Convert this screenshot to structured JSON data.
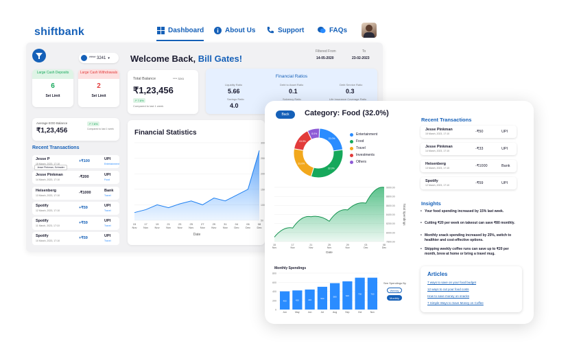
{
  "colors": {
    "brand": "#1560b8",
    "accent": "#2a8cff",
    "success": "#16a85b",
    "danger": "#e23b3b"
  },
  "nav": {
    "logo": "shiftbank",
    "items": [
      {
        "label": "Dashboard",
        "icon": "dashboard-icon",
        "active": true
      },
      {
        "label": "About Us",
        "icon": "info-icon",
        "active": false
      },
      {
        "label": "Support",
        "icon": "phone-icon",
        "active": false
      },
      {
        "label": "FAQs",
        "icon": "chat-icon",
        "active": false
      }
    ]
  },
  "dashboard": {
    "account": "**** 3241",
    "welcome": "Welcome Back,",
    "user": "Bill Gates!",
    "filter": {
      "from_label": "Filtered From",
      "to_label": "To",
      "from": "14-05-2020",
      "to": "23-02-2023"
    },
    "large_deposits": {
      "label": "Large Cash Deposits",
      "count": "6",
      "action": "Set Limit"
    },
    "large_withdrawals": {
      "label": "Large Cash Withdrawals",
      "count": "2",
      "action": "Set Limit"
    },
    "balance": {
      "label": "Total Balance",
      "account": "**** 3241",
      "value": "₹1,23,456",
      "change": "↗ 7.6%",
      "note": "Compared to last 1 week"
    },
    "eod": {
      "label": "Average EOD Balance",
      "value": "₹1,23,456",
      "change": "↗ 7.6%",
      "note": "Compared to last 1 week"
    },
    "ratios": {
      "title": "Financial Ratios",
      "items": [
        {
          "label": "Liquidity Ratio",
          "value": "5.66"
        },
        {
          "label": "Debt to Asset Ratio",
          "value": "0.1"
        },
        {
          "label": "Debt Service Ratio",
          "value": "0.3"
        },
        {
          "label": "Savings Ratio",
          "value": "4.0"
        },
        {
          "label": "Solvency Ratio",
          "value": ""
        },
        {
          "label": "Life Insurance Coverage Ratio",
          "value": ""
        }
      ]
    },
    "stats": {
      "title": "Financial Statistics",
      "xlabel": "Date"
    },
    "recent_title": "Recent Transactions",
    "tooltip": "Jesse Pinkman, Schrader",
    "transactions": [
      {
        "name": "Jesse P",
        "date": "15 March, 2023, 17:10",
        "amount": "+₹100",
        "mode": "UPI",
        "category": "Entertainment"
      },
      {
        "name": "Jesse Pinkman",
        "date": "14 March, 2023, 17:10",
        "amount": "-₹200",
        "mode": "UPI",
        "category": "Food"
      },
      {
        "name": "Heisenberg",
        "date": "13 March, 2023, 17:10",
        "amount": "-₹1000",
        "mode": "Bank",
        "category": "Travel"
      },
      {
        "name": "Spotify",
        "date": "12 March, 2023, 17:10",
        "amount": "+₹59",
        "mode": "UPI",
        "category": "Travel"
      },
      {
        "name": "Spotify",
        "date": "11 March, 2023, 17:10",
        "amount": "+₹59",
        "mode": "UPI",
        "category": "Travel"
      },
      {
        "name": "Spotify",
        "date": "10 March, 2023, 17:10",
        "amount": "+₹59",
        "mode": "UPI",
        "category": "Travel"
      }
    ]
  },
  "food": {
    "back": "Back",
    "title": "Category: Food (32.0%)",
    "legend": [
      {
        "label": "Entertainment",
        "color": "#2a8cff"
      },
      {
        "label": "Food",
        "color": "#16a85b"
      },
      {
        "label": "Travel",
        "color": "#f2a81d"
      },
      {
        "label": "Investments",
        "color": "#e23b3b"
      },
      {
        "label": "Others",
        "color": "#8e5bd6"
      }
    ],
    "recent_title": "Recent Transactions",
    "transactions": [
      {
        "name": "Jesse Pinkman",
        "date": "15 March, 2023, 17:10",
        "amount": "-₹50",
        "mode": "UPI"
      },
      {
        "name": "Jesse Pinkman",
        "date": "14 March, 2023, 17:10",
        "amount": "-₹33",
        "mode": "UPI"
      },
      {
        "name": "Heisenberg",
        "date": "13 March, 2023, 17:10",
        "amount": "-₹1000",
        "mode": "Bank"
      },
      {
        "name": "Spotify",
        "date": "12 March, 2023, 17:10",
        "amount": "-₹59",
        "mode": "UPI"
      }
    ],
    "insights_title": "Insights",
    "insights": [
      "Your food spending increased by 15% last week.",
      "Cutting ₹20 per week on takeout can save ₹80 monthly.",
      "Monthly snack spending increased by 25%, switch to healthier and cost-effective options.",
      "Skipping weekly coffee runs can save up to ₹20 per month, brew at home or bring a travel mug."
    ],
    "articles_title": "Articles",
    "articles": [
      "7 ways to save on your food budget",
      "12 ways to cut your food costs",
      "How to save money on snacks",
      "7 Simple Ways to Save Money on Coffee"
    ],
    "see_by": "See Spendings By",
    "weekly": "Weekly",
    "monthly": "Monthly"
  },
  "chart_data": [
    {
      "type": "pie",
      "title": "",
      "categories": [
        "Entertainment",
        "Food",
        "Travel",
        "Investments",
        "Others"
      ],
      "values": [
        22.0,
        32.0,
        23.0,
        15.0,
        8.0
      ],
      "value_labels": [
        "22.0%",
        "32.0%",
        "23.0%",
        "15.0%",
        "8.0%"
      ]
    },
    {
      "type": "area",
      "title": "Financial Statistics",
      "xlabel": "Date",
      "ylabel": "",
      "x": [
        "15 Nov",
        "17 Nov",
        "19 Nov",
        "21 Nov",
        "23 Nov",
        "25 Nov",
        "27 Nov",
        "29 Nov",
        "31 Nov",
        "04 Dec",
        "06 Dec",
        "08 Dec"
      ],
      "values": [
        1.6,
        1.75,
        2.0,
        1.85,
        2.05,
        2.2,
        2.0,
        2.35,
        2.2,
        2.5,
        2.8,
        4.8
      ],
      "ytick_labels": [
        "300",
        "250",
        "200",
        "150",
        "100",
        "50"
      ]
    },
    {
      "type": "area",
      "title": "",
      "xlabel": "Date",
      "ylabel": "Total Spendings",
      "x": [
        "15 Nov",
        "17 Nov",
        "21 Nov",
        "25 Nov",
        "29 Nov",
        "03 Dec",
        "08 Dec"
      ],
      "values": [
        7900,
        8100,
        8350,
        8250,
        8500,
        8650,
        9000
      ],
      "yticks": [
        7800,
        8000,
        8200,
        8400,
        8600,
        8800,
        9000
      ],
      "ytick_labels": [
        "7800.00",
        "8000.00",
        "8200.00",
        "8400.00",
        "8600.00",
        "8800.00",
        "9000.00"
      ],
      "ylim": [
        7800,
        9000
      ]
    },
    {
      "type": "bar",
      "title": "Monthly Spendings",
      "categories": [
        "Jun",
        "May",
        "Jun",
        "Jul",
        "Aug",
        "Sep",
        "Oct",
        "Nov"
      ],
      "values": [
        400,
        420,
        440,
        500,
        580,
        620,
        700,
        700
      ],
      "value_labels": [
        "400",
        "420",
        "440",
        "500",
        "580",
        "620",
        "700",
        "700"
      ],
      "yticks": [
        0,
        200,
        400,
        600,
        800
      ],
      "ylim": [
        0,
        800
      ]
    }
  ]
}
